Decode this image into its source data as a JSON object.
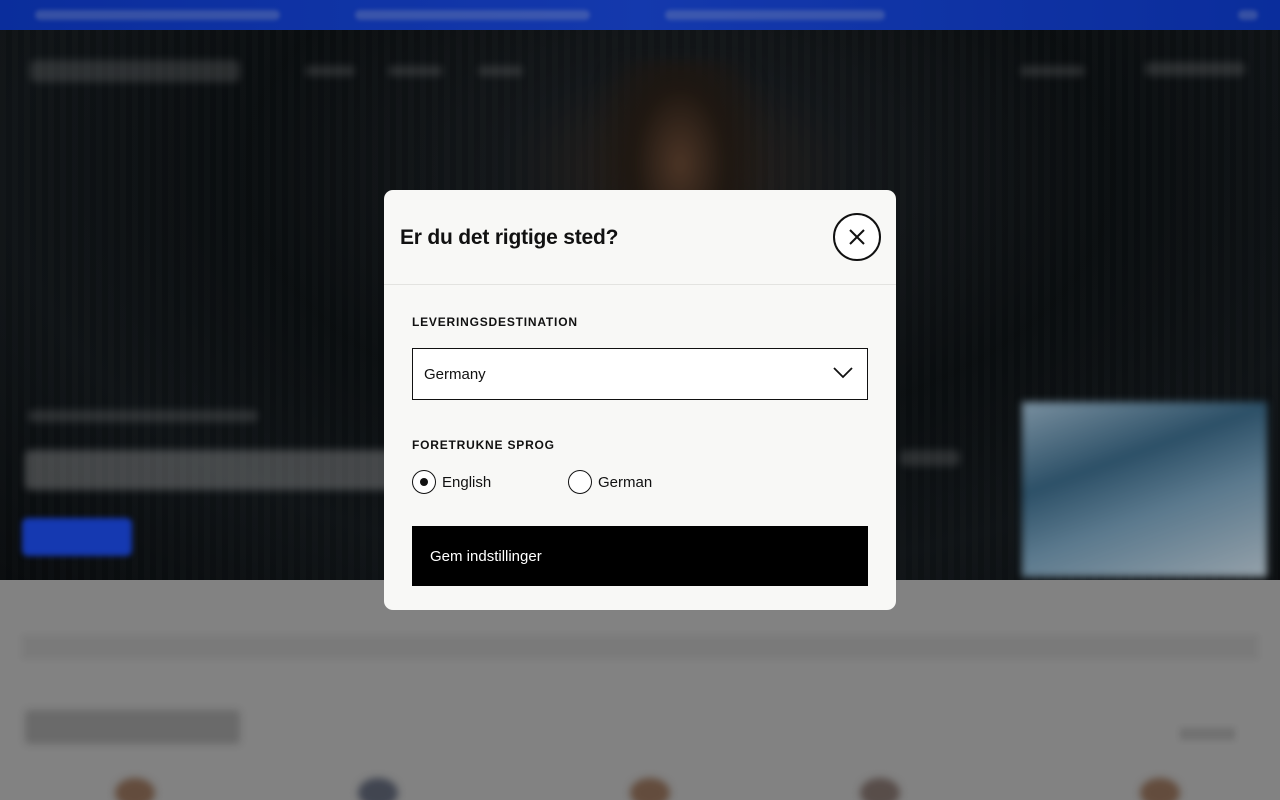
{
  "modal": {
    "title": "Er du det rigtige sted?",
    "close_icon": "close-icon",
    "delivery": {
      "label": "LEVERINGSDESTINATION",
      "selected": "Germany",
      "dropdown_icon": "chevron-down-icon"
    },
    "language": {
      "label": "FORETRUKNE SPROG",
      "options": [
        {
          "label": "English",
          "selected": true
        },
        {
          "label": "German",
          "selected": false
        }
      ]
    },
    "save_label": "Gem indstillinger"
  },
  "colors": {
    "accent_blue": "#1e4ff5",
    "button_bg": "#000000",
    "modal_bg": "#f8f8f6"
  }
}
